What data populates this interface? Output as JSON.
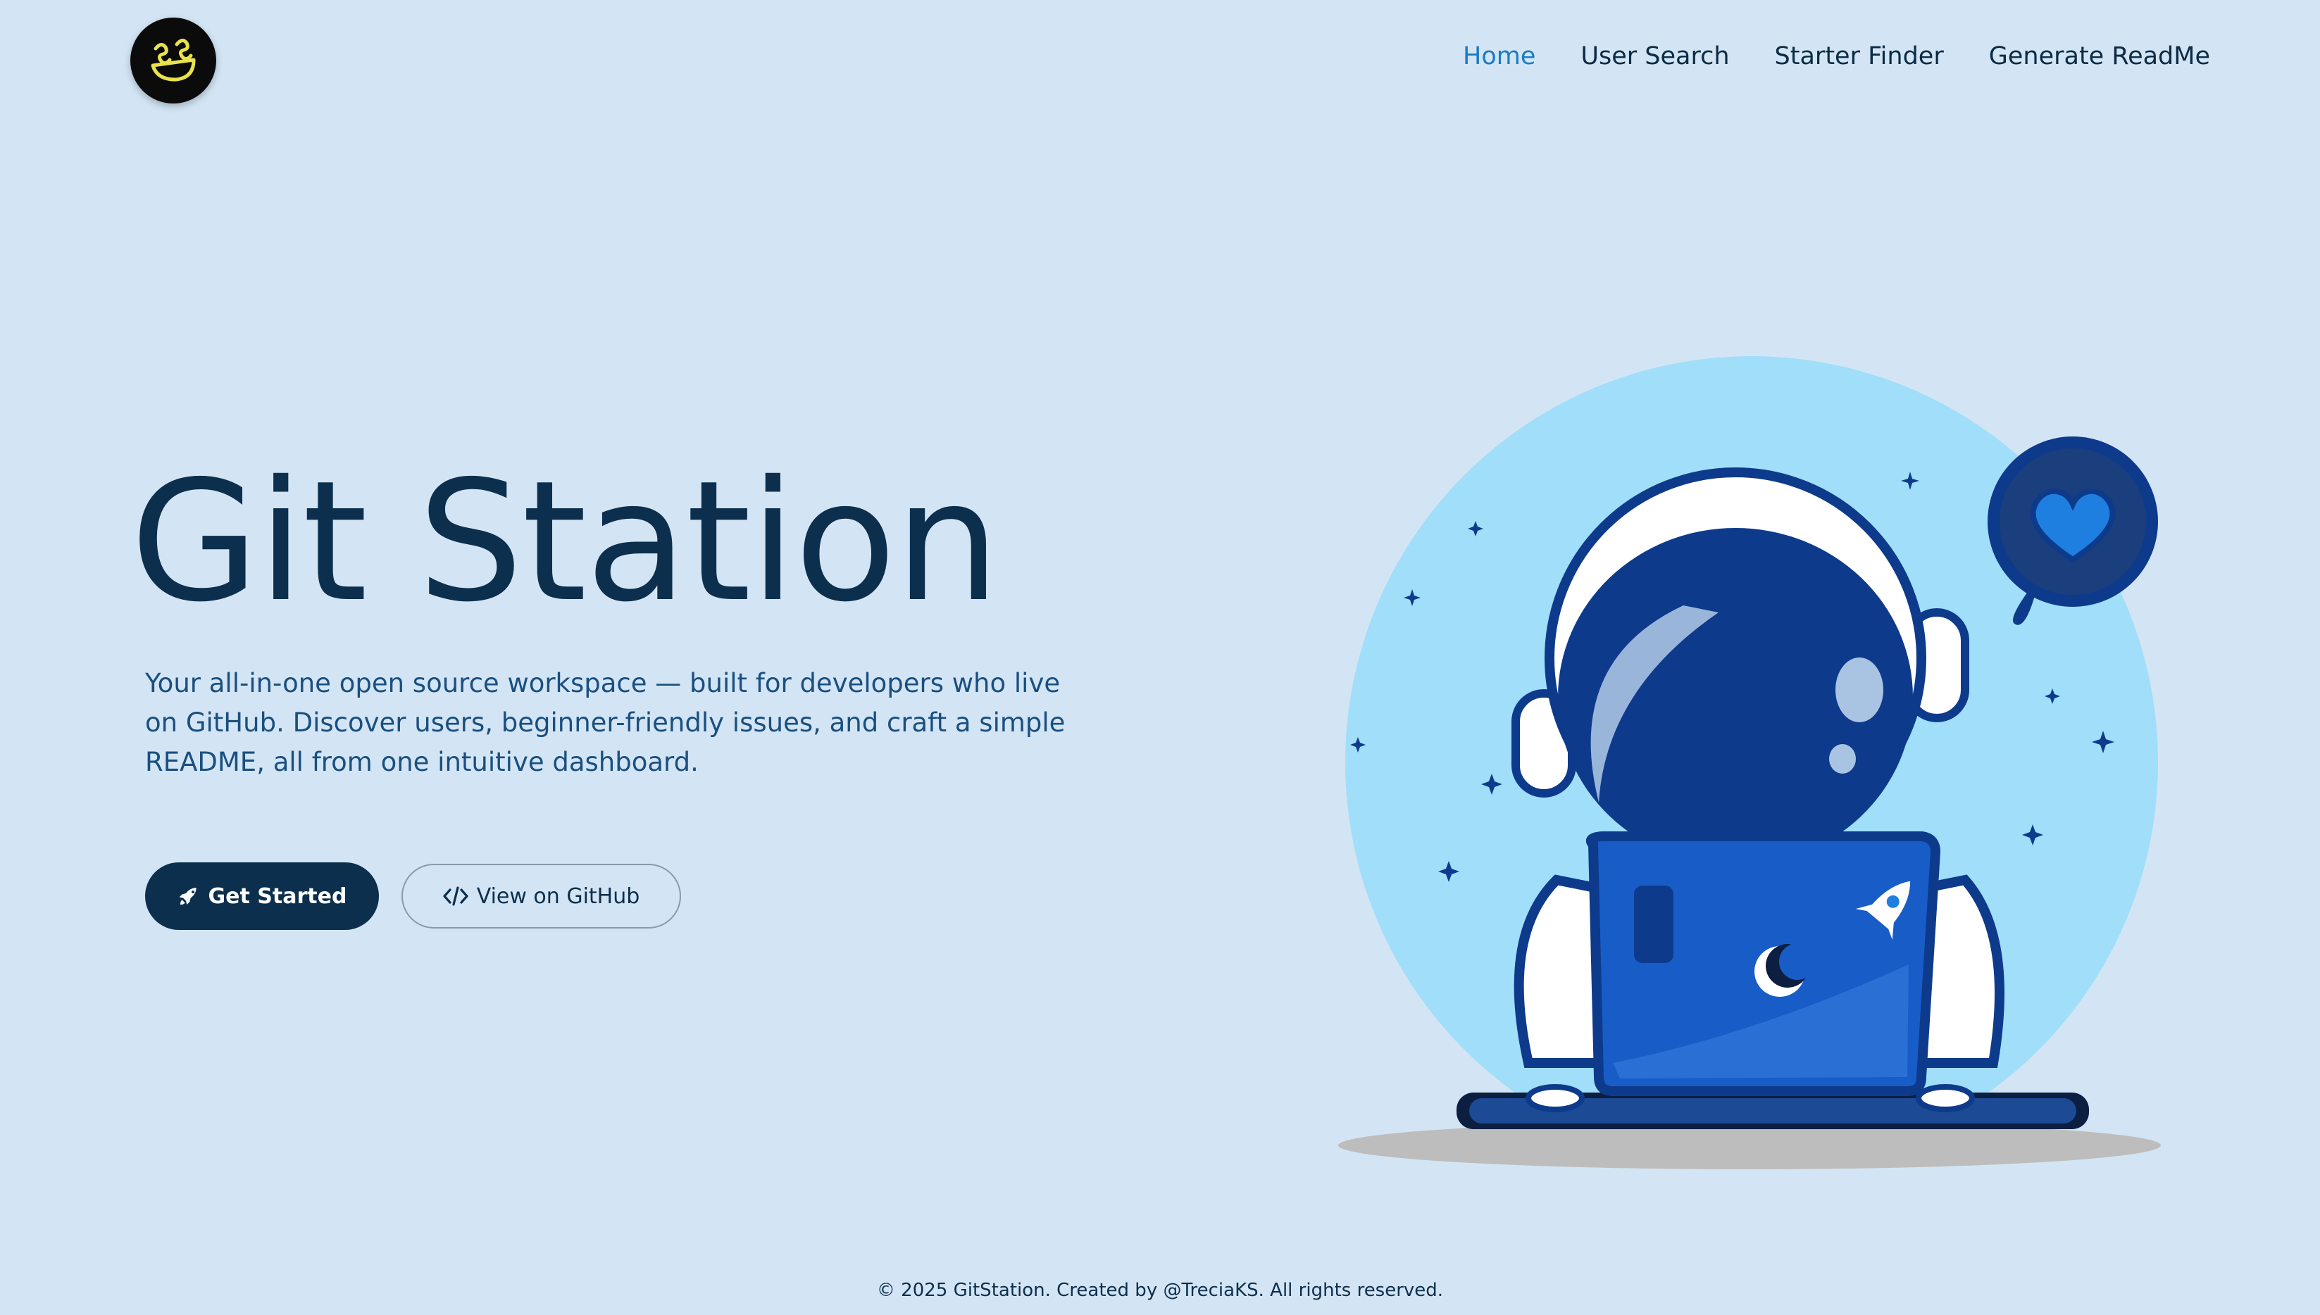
{
  "logo": {
    "text": "SS"
  },
  "nav": {
    "items": [
      {
        "label": "Home",
        "active": true
      },
      {
        "label": "User Search",
        "active": false
      },
      {
        "label": "Starter Finder",
        "active": false
      },
      {
        "label": "Generate ReadMe",
        "active": false
      }
    ]
  },
  "hero": {
    "title": "Git Station",
    "description": "Your all-in-one open source workspace — built for developers who live on GitHub. Discover users, beginner-friendly issues, and craft a simple README, all from one intuitive dashboard.",
    "primary_button": {
      "label": "Get Started",
      "icon": "rocket-icon"
    },
    "secondary_button": {
      "label": "View on GitHub",
      "icon": "code-icon"
    }
  },
  "illustration": {
    "subject": "astronaut-with-laptop",
    "bubble_icon": "heart-icon",
    "laptop_stickers": [
      "rocket",
      "moon"
    ]
  },
  "footer": {
    "text": "© 2025 GitStation. Created by @TreciaKS. All rights reserved."
  },
  "colors": {
    "background": "#d3e5f4",
    "primary_dark": "#0c2f4d",
    "accent_blue": "#1b7bc4",
    "illustration_circle": "#a0defa",
    "astronaut_blue": "#0e3a8c",
    "laptop_blue": "#185cc8"
  }
}
